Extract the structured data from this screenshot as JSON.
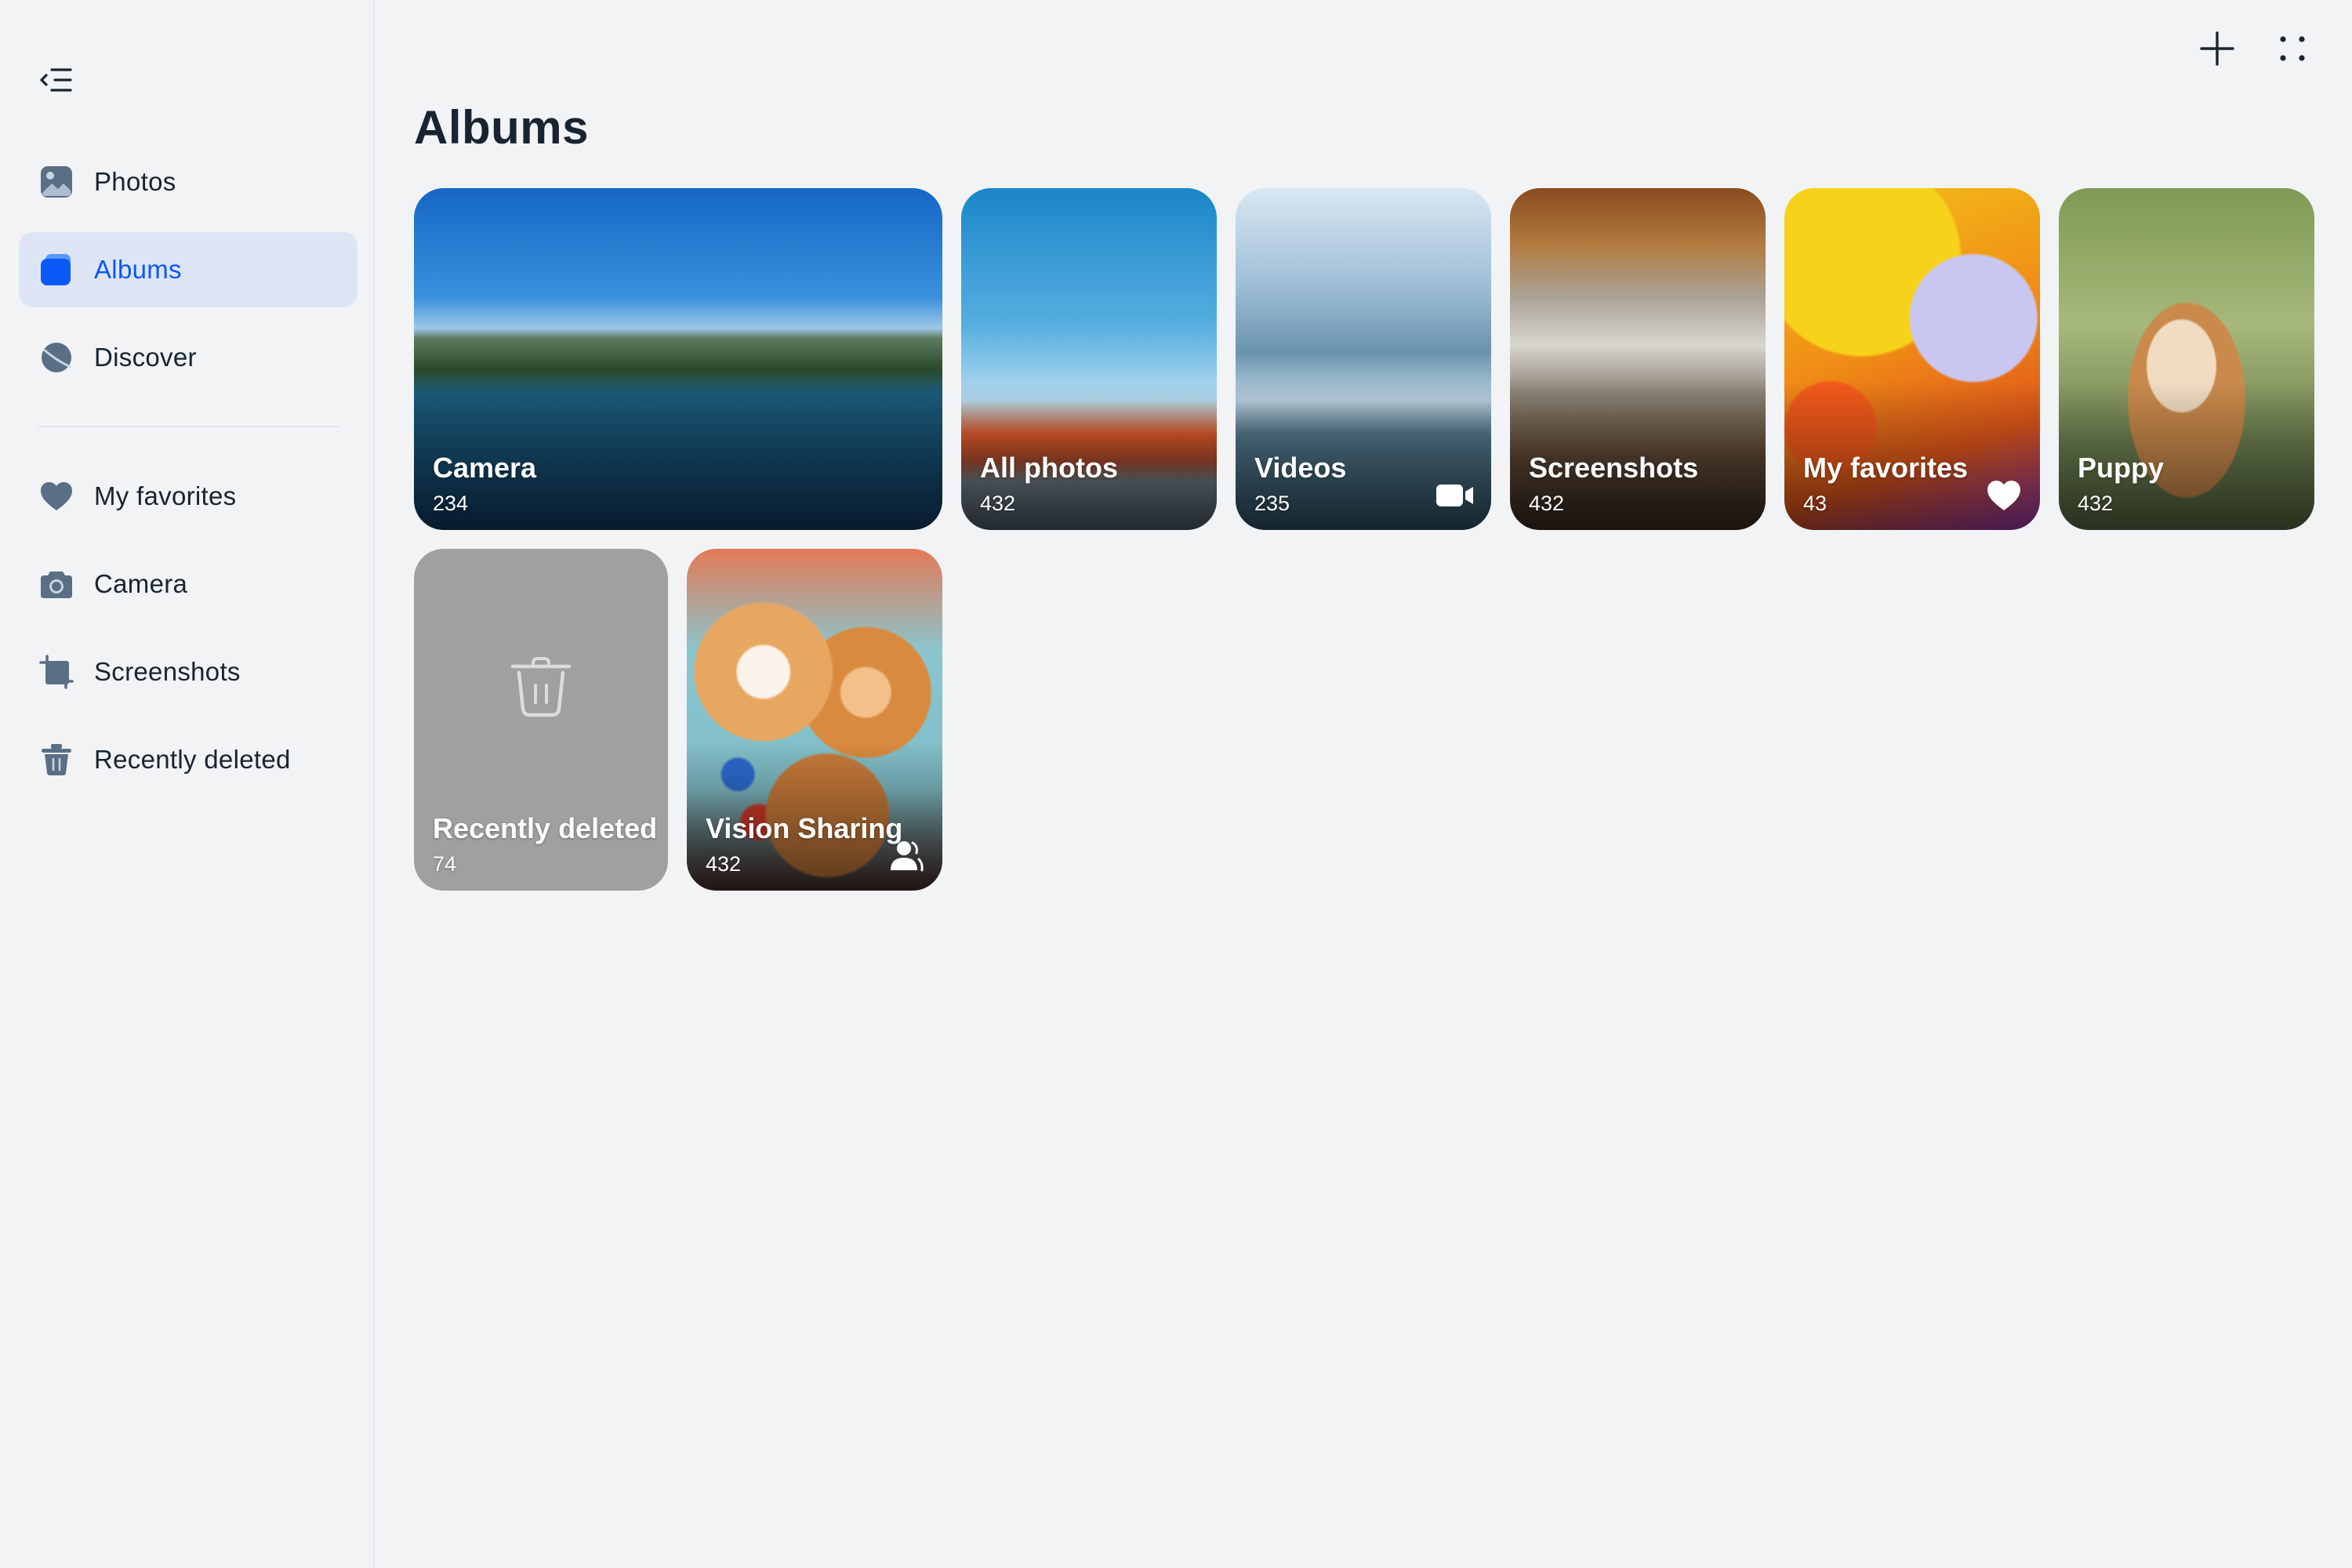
{
  "sidebar": {
    "items": [
      {
        "label": "Photos",
        "icon": "photos-icon",
        "active": false
      },
      {
        "label": "Albums",
        "icon": "albums-icon",
        "active": true
      },
      {
        "label": "Discover",
        "icon": "discover-icon",
        "active": false
      },
      {
        "label": "My favorites",
        "icon": "heart-icon",
        "active": false
      },
      {
        "label": "Camera",
        "icon": "camera-icon",
        "active": false
      },
      {
        "label": "Screenshots",
        "icon": "screenshot-icon",
        "active": false
      },
      {
        "label": "Recently deleted",
        "icon": "trash-icon",
        "active": false
      }
    ]
  },
  "header": {
    "title": "Albums"
  },
  "albums": [
    {
      "name": "Camera",
      "count": "234"
    },
    {
      "name": "All photos",
      "count": "432"
    },
    {
      "name": "Videos",
      "count": "235",
      "badge": "video-camera-icon"
    },
    {
      "name": "Screenshots",
      "count": "432"
    },
    {
      "name": "My favorites",
      "count": "43",
      "badge": "heart-icon"
    },
    {
      "name": "Puppy",
      "count": "432"
    },
    {
      "name": "Recently deleted",
      "count": "74",
      "center_icon": "trash-icon"
    },
    {
      "name": "Vision Sharing",
      "count": "432",
      "badge": "shared-user-icon"
    }
  ],
  "colors": {
    "background": "#f1f3f5",
    "accent": "#0a59f7",
    "active_item_bg": "#dde5f5",
    "icon_gray": "#5a6f85",
    "text_primary": "#182431"
  }
}
